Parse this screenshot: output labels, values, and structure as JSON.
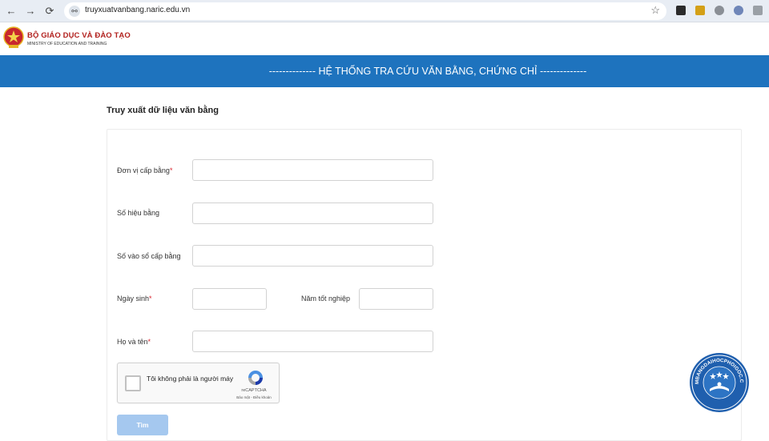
{
  "browser": {
    "url": "truyxuatvanbang.naric.edu.vn",
    "back_glyph": "←",
    "forward_glyph": "→",
    "reload_glyph": "⟳",
    "star_glyph": "☆",
    "site_info_glyph": "⚯"
  },
  "ministry": {
    "name_vn": "BỘ GIÁO DỤC VÀ ĐÀO TẠO",
    "name_en": "MINISTRY OF EDUCATION AND TRAINING",
    "emblem_color": "#c8272d"
  },
  "banner": {
    "title": "--------------   HỆ THỐNG TRA CỨU VĂN BẰNG, CHỨNG CHỈ   --------------",
    "color": "#1e73be"
  },
  "form": {
    "heading": "Truy xuất dữ liệu văn bằng",
    "required_mark": "*",
    "fields": {
      "don_vi": {
        "label": "Đơn vị cấp bằng",
        "value": ""
      },
      "so_hieu": {
        "label": "Số hiệu bằng",
        "value": ""
      },
      "so_vao_so": {
        "label": "Số vào sổ cấp bằng",
        "value": ""
      },
      "ngay_sinh": {
        "label": "Ngày sinh",
        "value": ""
      },
      "nam_tot_nghiep": {
        "label": "Năm tốt nghiệp",
        "value": ""
      },
      "ho_ten": {
        "label": "Họ và tên",
        "value": ""
      }
    },
    "search_button": "Tìm"
  },
  "captcha": {
    "text": "Tôi không phải là người máy",
    "brand": "reCAPTCHA",
    "links": "Bảo mật - Điều khoản"
  },
  "watermark": {
    "text": "LAMBANGDAIHOCPHOIGOC.COM"
  }
}
